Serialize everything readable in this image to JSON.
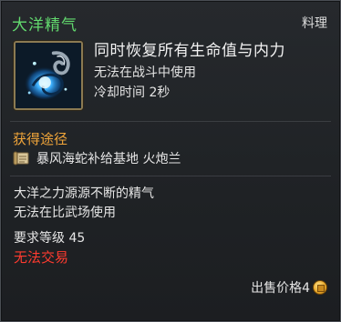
{
  "item": {
    "name": "大洋精气",
    "type": "料理",
    "description": "同时恢复所有生命值与内力",
    "restriction": "无法在战斗中使用",
    "cooldown": "冷却时间 2秒",
    "icon": "ocean-essence-orb-icon"
  },
  "source": {
    "title": "获得途径",
    "location": "暴风海蛇补给基地 火炮兰",
    "icon": "scroll-icon"
  },
  "lore": {
    "line1": "大洋之力源源不断的精气",
    "line2": "无法在比武场使用"
  },
  "requirements": {
    "level": "要求等级 45",
    "trade": "无法交易"
  },
  "price": {
    "label": "出售价格4",
    "icon": "copper-coin-icon"
  },
  "colors": {
    "name": "#62d96e",
    "source_title": "#f0a53a",
    "untradable": "#ff3b2f",
    "background": "#1f2225"
  }
}
